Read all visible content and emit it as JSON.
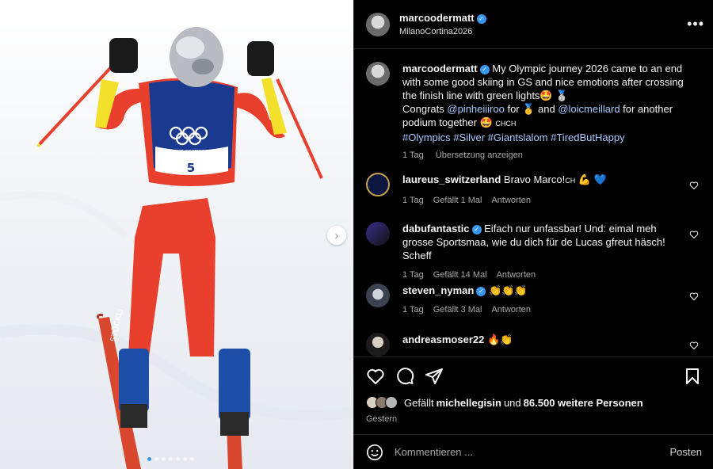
{
  "post": {
    "username": "marcoodermatt",
    "location": "MilanoCortina2026",
    "more_label": "•••"
  },
  "media": {
    "bib_number": "5",
    "event_logo_text": "MILANO CORTINA 2026",
    "ski_brand": "STÖCKLI",
    "next_arrow": "›",
    "carousel_dots": 7,
    "active_dot": 0
  },
  "caption": {
    "username": "marcoodermatt",
    "text_1": "My Olympic journey 2026 came to an end with some good skiing in GS and nice emotions after crossing the finish line with green lights🤩 🥈",
    "text_2a": "Congrats ",
    "mention_1": "@pinheiiiroo",
    "text_2b": " for 🥇 and ",
    "mention_2": "@loicmeillard",
    "text_2c": " for another podium together 🤩",
    "flag": "CHCH",
    "hashtags": "#Olympics #Silver #Giantslalom #TiredButHappy",
    "time": "1 Tag",
    "translate": "Übersetzung anzeigen"
  },
  "comments": [
    {
      "username": "laureus_switzerland",
      "verified": false,
      "text": "Bravo Marco!",
      "flag": "CH",
      "emoji": "💪 💙",
      "time": "1 Tag",
      "likes": "Gefällt 1 Mal",
      "reply": "Antworten"
    },
    {
      "username": "dabufantastic",
      "verified": true,
      "text": "Eifach nur unfassbar! Und: eimal meh grosse Sportsmaa, wie du dich für de Lucas gfreut häsch! Scheff",
      "time": "1 Tag",
      "likes": "Gefällt 14 Mal",
      "reply": "Antworten"
    },
    {
      "username": "steven_nyman",
      "verified": true,
      "text": "👏👏👏",
      "time": "1 Tag",
      "likes": "Gefällt 3 Mal",
      "reply": "Antworten"
    },
    {
      "username": "andreasmoser22",
      "verified": false,
      "text": "🔥👏"
    }
  ],
  "likes": {
    "prefix": "Gefällt ",
    "user": "michellegisin",
    "middle": " und ",
    "count": "86.500 weitere Personen",
    "date": "Gestern"
  },
  "composer": {
    "placeholder": "Kommentieren ...",
    "post_label": "Posten"
  },
  "colors": {
    "accent": "#3897f0",
    "link": "#a9c7ff",
    "suit_red": "#e8402c",
    "suit_yellow": "#f3e02b",
    "bib_blue": "#1a3a8f"
  }
}
